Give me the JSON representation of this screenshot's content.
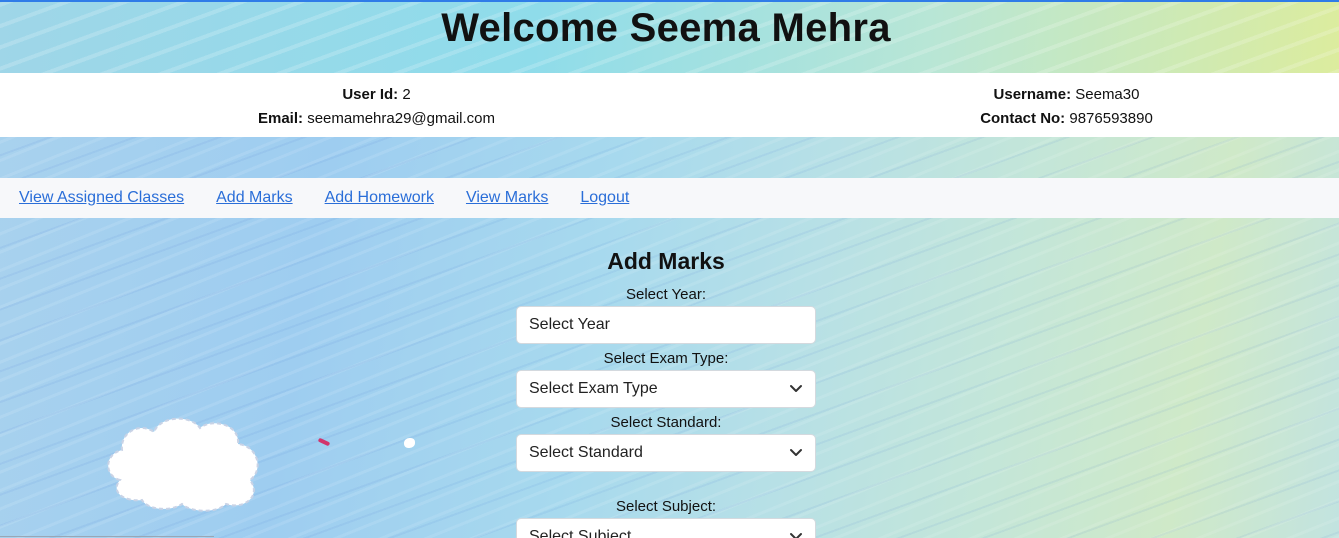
{
  "header": {
    "welcome": "Welcome Seema Mehra"
  },
  "profile": {
    "user_id_label": "User Id:",
    "user_id": "2",
    "email_label": "Email:",
    "email": "seemamehra29@gmail.com",
    "username_label": "Username:",
    "username": "Seema30",
    "contact_label": "Contact No:",
    "contact": "9876593890"
  },
  "nav": {
    "items": [
      {
        "label": "View Assigned Classes"
      },
      {
        "label": "Add Marks"
      },
      {
        "label": "Add Homework"
      },
      {
        "label": "View Marks"
      },
      {
        "label": "Logout"
      }
    ]
  },
  "form": {
    "title": "Add Marks",
    "year_label": "Select Year:",
    "year_value": "Select Year",
    "exam_label": "Select Exam Type:",
    "exam_value": "Select Exam Type",
    "standard_label": "Select Standard:",
    "standard_value": "Select Standard",
    "subject_label": "Select Subject:",
    "subject_value": "Select Subject"
  },
  "icons": {
    "dropdown": "chevron-down-icon",
    "decoration": "cloud-icon"
  },
  "colors": {
    "link": "#2a6ed8",
    "accent": "#2f7ce8"
  }
}
